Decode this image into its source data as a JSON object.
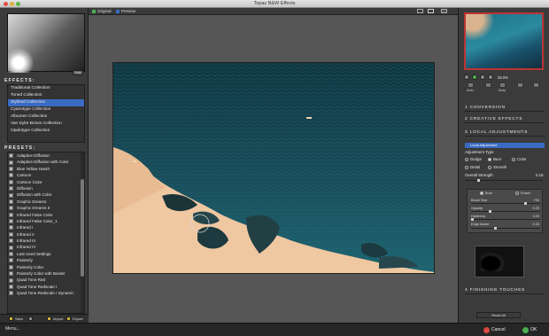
{
  "window": {
    "title": "Topaz B&W Effects"
  },
  "left": {
    "hide_label": "Hide",
    "effects_heading": "EFFECTS:",
    "collections": [
      {
        "label": "Traditional Collection",
        "selected": false
      },
      {
        "label": "Toned Collection",
        "selected": false
      },
      {
        "label": "Stylized Collection",
        "selected": true
      },
      {
        "label": "Cyanotype Collection",
        "selected": false
      },
      {
        "label": "Albumen Collection",
        "selected": false
      },
      {
        "label": "Van Dyke Brown Collection",
        "selected": false
      },
      {
        "label": "Opalotype Collection",
        "selected": false
      }
    ],
    "presets_heading": "PRESETS:",
    "presets": [
      "Adaptive Diffusion",
      "Adaptive Diffusion with Color",
      "Blue Yellow Harsh",
      "Cartoon",
      "Cartoon Color",
      "Diffusion",
      "Diffusion with Color",
      "Graphic Dreams",
      "Graphic Dreams II",
      "Infrared False Color",
      "Infrared False Color_1",
      "Infrared I",
      "Infrared II",
      "Infrared III",
      "Infrared IV",
      "Last Used Settings",
      "Painterly",
      "Painterly Color",
      "Painterly Color with Border",
      "Quad Tone Red",
      "Quad Tone Redscale I",
      "Quad Tone Redscale I Dynamic"
    ],
    "bottom": {
      "save": "Save",
      "import": "Import",
      "export": "Export"
    }
  },
  "center": {
    "tab_original": "Original",
    "tab_preview": "Preview"
  },
  "right": {
    "zoom_value": "26.0%",
    "tools": [
      "Undo",
      "Snap"
    ],
    "sections": {
      "conversion": "1 CONVERSION",
      "creative": "2 CREATIVE EFFECTS",
      "local": "3 LOCAL ADJUSTMENTS",
      "finishing": "4 FINISHING TOUCHES"
    },
    "local_adjustment_label": "Local Adjustment",
    "adjustment_type_label": "Adjustment Type",
    "types": [
      "Dodge",
      "Burn",
      "Color",
      "Detail",
      "Smooth"
    ],
    "overall_strength_label": "Overall Strength",
    "overall_strength_value": "0.16",
    "burn_label": "Burn",
    "eraser_label": "Eraser",
    "brush_size_label": "Brush Size",
    "brush_size_value": "700",
    "opacity_label": "Opacity",
    "opacity_value": "0.25",
    "hardness_label": "Hardness",
    "hardness_value": "0.00",
    "edge_aware_label": "Edge Aware",
    "edge_aware_value": "0.33",
    "reset_all": "Reset All"
  },
  "bottombar": {
    "menu": "Menu...",
    "cancel": "Cancel",
    "ok": "OK"
  },
  "colors": {
    "selection": "#3a6bc2",
    "ocean": "#173d49",
    "sand": "#f0c9a4",
    "nav_border": "#b33333"
  }
}
